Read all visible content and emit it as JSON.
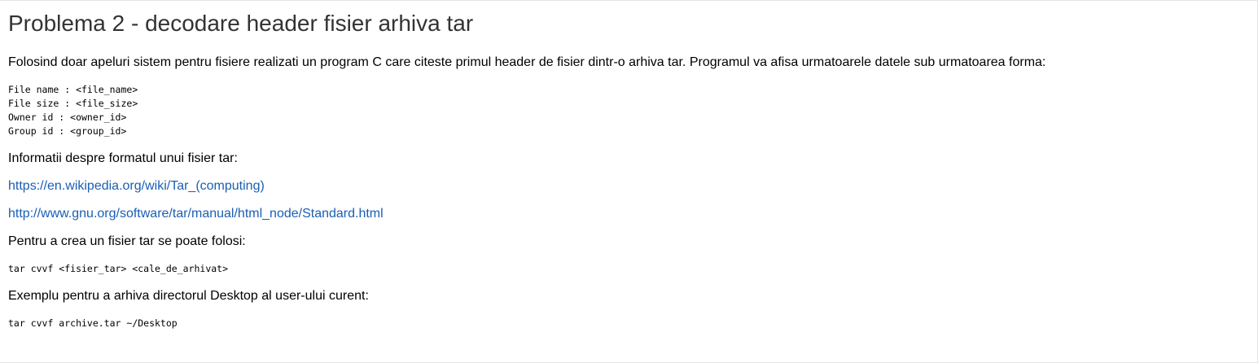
{
  "title": "Problema 2 - decodare header fisier arhiva tar",
  "intro": "Folosind doar apeluri sistem pentru fisiere realizati un program C care citeste primul header de fisier dintr-o arhiva tar. Programul va afisa urmatoarele datele sub urmatoarea forma:",
  "output_format": [
    "File name : <file_name>",
    "File size : <file_size>",
    "Owner id : <owner_id>",
    "Group id : <group_id>"
  ],
  "info_heading": "Informatii despre formatul unui fisier tar:",
  "links": [
    "https://en.wikipedia.org/wiki/Tar_(computing)",
    "http://www.gnu.org/software/tar/manual/html_node/Standard.html"
  ],
  "create_text": "Pentru a crea un fisier tar se poate folosi:",
  "create_command": "tar cvvf <fisier_tar> <cale_de_arhivat>",
  "example_text": "Exemplu pentru a arhiva directorul Desktop al user-ului curent:",
  "example_command": "tar cvvf archive.tar ~/Desktop",
  "colors": {
    "title": "#333333",
    "link": "#1a5fb4",
    "border": "#e4e4e4"
  }
}
